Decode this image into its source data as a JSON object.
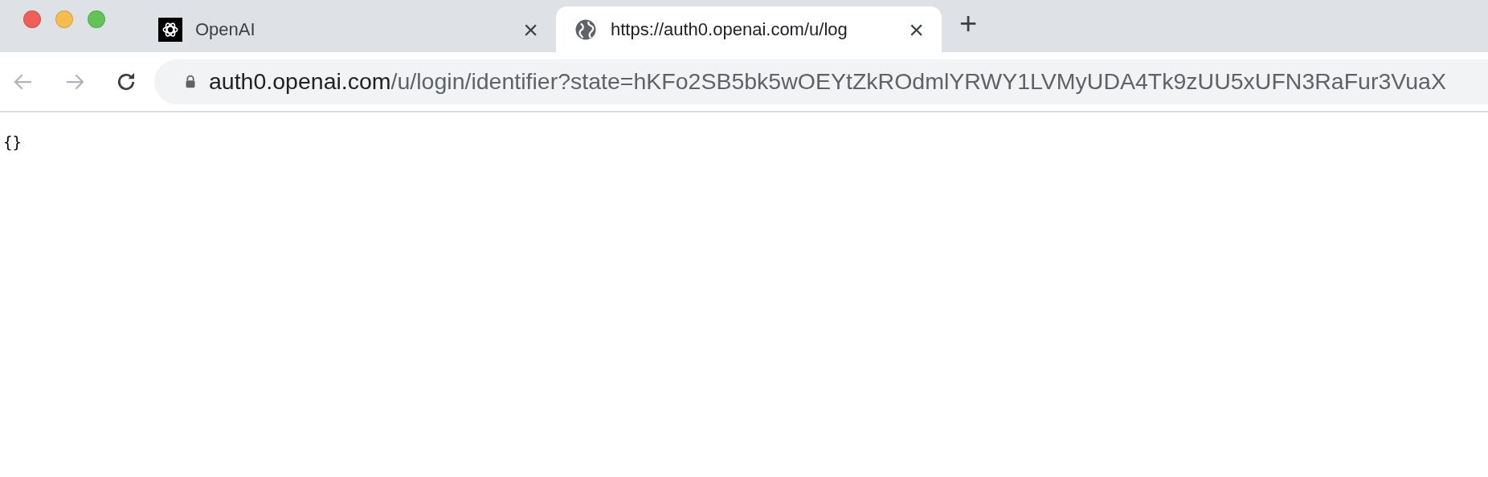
{
  "tabs": [
    {
      "title": "OpenAI",
      "kind": "logo",
      "selected": false,
      "close": "×"
    },
    {
      "title": "https://auth0.openai.com/u/log",
      "kind": "globe",
      "selected": true,
      "close": "×"
    }
  ],
  "new_tab": "+",
  "address_bar": {
    "host": "auth0.openai.com",
    "path": "/u/login/identifier?state=hKFo2SB5bk5wOEYtZkROdmlYRWY1LVMyUDA4Tk9zUU5xUFN3RaFur3VuaX"
  },
  "page": {
    "text": "{}"
  }
}
